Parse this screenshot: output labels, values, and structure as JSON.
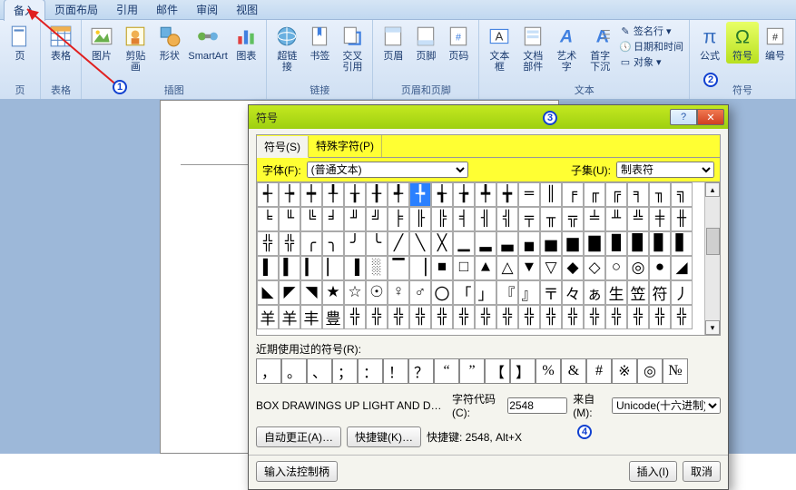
{
  "ribbon_tabs": [
    "备入",
    "页面布局",
    "引用",
    "邮件",
    "审阅",
    "视图"
  ],
  "ribbon_active_tab": 0,
  "groups": {
    "g0": {
      "label": "页",
      "items": [
        {
          "label": "页"
        }
      ]
    },
    "tables": {
      "label": "表格",
      "items": [
        {
          "label": "表格"
        }
      ]
    },
    "illustrations": {
      "label": "插图",
      "items": [
        {
          "label": "图片"
        },
        {
          "label": "剪贴画"
        },
        {
          "label": "形状"
        },
        {
          "label": "SmartArt"
        },
        {
          "label": "图表"
        }
      ]
    },
    "links": {
      "label": "链接",
      "items": [
        {
          "label": "超链接"
        },
        {
          "label": "书签"
        },
        {
          "label": "交叉\n引用"
        }
      ]
    },
    "headerfooter": {
      "label": "页眉和页脚",
      "items": [
        {
          "label": "页眉"
        },
        {
          "label": "页脚"
        },
        {
          "label": "页码"
        }
      ]
    },
    "text": {
      "label": "文本",
      "items": [
        {
          "label": "文本框"
        },
        {
          "label": "文档部件"
        },
        {
          "label": "艺术字"
        },
        {
          "label": "首字下沉"
        }
      ],
      "small": [
        {
          "label": "签名行 ▾"
        },
        {
          "label": "日期和时间"
        },
        {
          "label": "对象 ▾"
        }
      ]
    },
    "symbols": {
      "label": "符号",
      "items": [
        {
          "label": "公式"
        },
        {
          "label": "符号"
        },
        {
          "label": "编号"
        }
      ]
    }
  },
  "dialog": {
    "title": "符号",
    "tabs": [
      {
        "label": "符号(S)"
      },
      {
        "label": "特殊字符(P)"
      }
    ],
    "font_label": "字体(F):",
    "font_value": "(普通文本)",
    "subset_label": "子集(U):",
    "subset_value": "制表符",
    "recent_label": "近期使用过的符号(R):",
    "char_name": "BOX DRAWINGS UP LIGHT AND DOWN H…",
    "code_label": "字符代码(C):",
    "code_value": "2548",
    "from_label": "来自(M):",
    "from_value": "Unicode(十六进制)",
    "autocorrect_btn": "自动更正(A)…",
    "shortcut_btn": "快捷键(K)…",
    "shortcut_label": "快捷键: 2548, Alt+X",
    "ime_btn": "输入法控制柄",
    "insert_btn": "插入(I)",
    "cancel_btn": "取消",
    "help": "?",
    "close": "✕"
  },
  "chart_data": {
    "type": "table",
    "title": "Symbol grid",
    "columns": 20,
    "selected_index": 7,
    "cells": [
      "┽",
      "┾",
      "┿",
      "╀",
      "╁",
      "╂",
      "╃",
      "╄",
      "╅",
      "╆",
      "╇",
      "╈",
      "═",
      "║",
      "╒",
      "╓",
      "╔",
      "╕",
      "╖",
      "╗",
      "╘",
      "╙",
      "╚",
      "╛",
      "╜",
      "╝",
      "╞",
      "╟",
      "╠",
      "╡",
      "╢",
      "╣",
      "╤",
      "╥",
      "╦",
      "╧",
      "╨",
      "╩",
      "╪",
      "╫",
      "╬",
      "╬",
      "╭",
      "╮",
      "╯",
      "╰",
      "╱",
      "╲",
      "╳",
      "▁",
      "▂",
      "▃",
      "▄",
      "▅",
      "▆",
      "▇",
      "█",
      "▉",
      "▊",
      "▋",
      "▌",
      "▍",
      "▎",
      "▏",
      "▐",
      "░",
      "▔",
      "▕",
      "■",
      "□",
      "▲",
      "△",
      "▼",
      "▽",
      "◆",
      "◇",
      "○",
      "◎",
      "●",
      "◢",
      "◣",
      "◤",
      "◥",
      "★",
      "☆",
      "☉",
      "♀",
      "♂",
      "〇",
      "「",
      "」",
      "『",
      "』",
      "〒",
      "々",
      "ぁ",
      "生",
      "笠",
      "符",
      "丿",
      "羊",
      "羊",
      "丰",
      "豊",
      "╬",
      "╬",
      "╬",
      "╬",
      "╬",
      "╬",
      "╬",
      "╬",
      "╬",
      "╬",
      "╬",
      "╬",
      "╬",
      "╬",
      "╬",
      "╬"
    ],
    "recent": [
      "，",
      "。",
      "、",
      "；",
      "：",
      "！",
      "？",
      "“",
      "”",
      "【",
      "】",
      "%",
      "&",
      "#",
      "※",
      "◎",
      "№"
    ]
  },
  "callouts": {
    "c1": "1",
    "c2": "2",
    "c3": "3",
    "c4": "4"
  }
}
